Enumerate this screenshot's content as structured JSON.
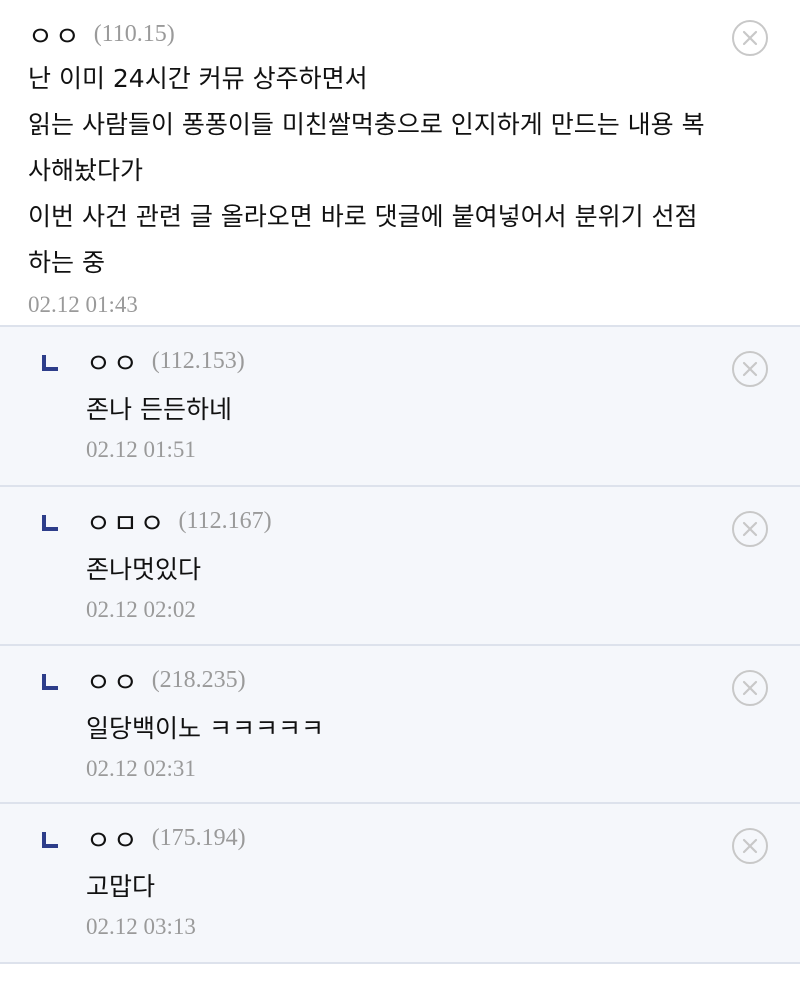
{
  "comments": [
    {
      "nick": "ㅇㅇ",
      "ip": "(110.15)",
      "lines": [
        "난 이미 24시간 커뮤 상주하면서",
        "읽는 사람들이 퐁퐁이들 미친쌀먹충으로 인지하게 만드는 내용 복",
        "사해놨다가",
        "이번 사건 관련 글 올라오면 바로 댓글에 붙여넣어서 분위기 선점",
        "하는 중"
      ],
      "date": "02.12 01:43"
    }
  ],
  "replies": [
    {
      "nick": "ㅇㅇ",
      "ip": "(112.153)",
      "text": "존나 든든하네",
      "date": "02.12 01:51"
    },
    {
      "nick": "ㅇㅁㅇ",
      "ip": "(112.167)",
      "text": "존나멋있다",
      "date": "02.12 02:02"
    },
    {
      "nick": "ㅇㅇ",
      "ip": "(218.235)",
      "text": "일당백이노 ㅋㅋㅋㅋㅋ",
      "date": "02.12 02:31"
    },
    {
      "nick": "ㅇㅇ",
      "ip": "(175.194)",
      "text": "고맙다",
      "date": "02.12 03:13"
    }
  ],
  "icons": {
    "delete": "close-circle-icon",
    "reply": "reply-arrow-icon"
  },
  "colors": {
    "reply_bg": "#f5f7fb",
    "reply_arrow": "#2d3d8a",
    "meta_text": "#9a9a9a",
    "divider": "#dde2ec"
  }
}
